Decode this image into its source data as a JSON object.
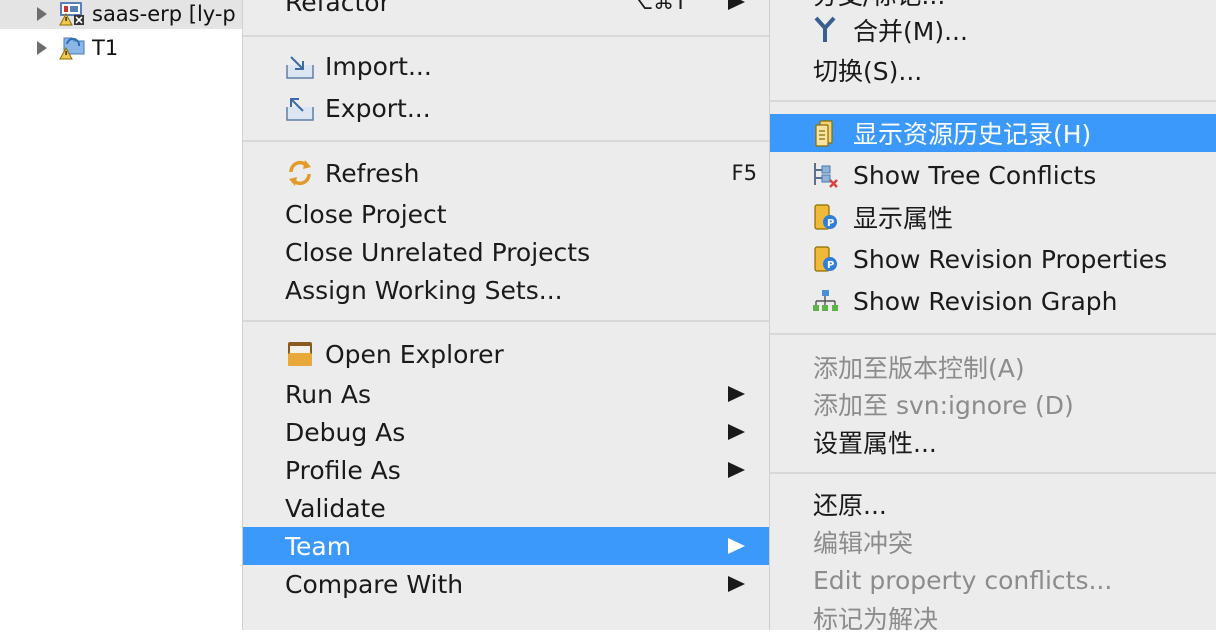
{
  "tree": {
    "items": [
      {
        "label": "saas-erp [ly-p",
        "selected": true
      },
      {
        "label": "T1",
        "selected": false
      }
    ]
  },
  "context_menu": {
    "items": [
      {
        "label": "Refactor",
        "shortcut": "⌥⌘T",
        "submenu": true
      },
      {
        "label": "Import...",
        "icon": "import-icon"
      },
      {
        "label": "Export...",
        "icon": "export-icon"
      },
      {
        "label": "Refresh",
        "shortcut": "F5",
        "icon": "refresh-icon"
      },
      {
        "label": "Close Project"
      },
      {
        "label": "Close Unrelated Projects"
      },
      {
        "label": "Assign Working Sets..."
      },
      {
        "label": "Open Explorer",
        "icon": "folder-icon"
      },
      {
        "label": "Run As",
        "submenu": true
      },
      {
        "label": "Debug As",
        "submenu": true
      },
      {
        "label": "Profile As",
        "submenu": true
      },
      {
        "label": "Validate"
      },
      {
        "label": "Team",
        "submenu": true,
        "highlighted": true
      },
      {
        "label": "Compare With",
        "submenu": true
      }
    ]
  },
  "team_submenu": {
    "items": [
      {
        "label": "分支/标记..."
      },
      {
        "label": "合并(M)...",
        "icon": "merge-icon"
      },
      {
        "label": "切换(S)..."
      },
      {
        "label": "显示资源历史记录(H)",
        "icon": "history-icon",
        "highlighted": true
      },
      {
        "label": "Show Tree Conflicts",
        "icon": "tree-conflicts-icon"
      },
      {
        "label": "显示属性",
        "icon": "properties-icon"
      },
      {
        "label": "Show Revision Properties",
        "icon": "revision-properties-icon"
      },
      {
        "label": "Show Revision Graph",
        "icon": "revision-graph-icon"
      },
      {
        "label": "添加至版本控制(A)",
        "disabled": true
      },
      {
        "label": "添加至 svn:ignore (D)",
        "disabled": true
      },
      {
        "label": "设置属性..."
      },
      {
        "label": "还原..."
      },
      {
        "label": "编辑冲突",
        "disabled": true
      },
      {
        "label": "Edit property conflicts...",
        "disabled": true
      },
      {
        "label": "标记为解决",
        "disabled": true
      }
    ]
  },
  "colors": {
    "highlight": "#3b99fc",
    "menu_background": "#ececec",
    "disabled_text": "#8c8c8c"
  }
}
